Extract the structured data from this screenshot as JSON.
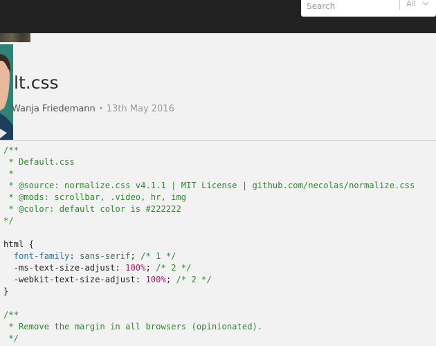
{
  "header": {
    "search_placeholder": "Search",
    "filter_label": "All",
    "colors": {
      "bar": "#222222"
    }
  },
  "post": {
    "title": "lt.css",
    "author": "Wanja Friedemann",
    "separator": "•",
    "date": "13th May 2016"
  },
  "code": {
    "lines": [
      [
        {
          "t": "/**",
          "k": "c"
        }
      ],
      [
        {
          "t": " * Default.css",
          "k": "c"
        }
      ],
      [
        {
          "t": " *",
          "k": "c"
        }
      ],
      [
        {
          "t": " * @source: normalize.css v4.1.1 | MIT License | github.com/necolas/normalize.css",
          "k": "c"
        }
      ],
      [
        {
          "t": " * @mods: scrollbar, .video, hr, img",
          "k": "c"
        }
      ],
      [
        {
          "t": " * @color: default color is #222222",
          "k": "c"
        }
      ],
      [
        {
          "t": "*/",
          "k": "c"
        }
      ],
      [],
      [
        {
          "t": "html {",
          "k": ""
        }
      ],
      [
        {
          "t": "  ",
          "k": ""
        },
        {
          "t": "font-family",
          "k": "p"
        },
        {
          "t": ": ",
          "k": ""
        },
        {
          "t": "sans-serif",
          "k": "v"
        },
        {
          "t": "; ",
          "k": ""
        },
        {
          "t": "/* 1 */",
          "k": "c"
        }
      ],
      [
        {
          "t": "  -ms-text-size-adjust: ",
          "k": ""
        },
        {
          "t": "100%",
          "k": "n"
        },
        {
          "t": "; ",
          "k": ""
        },
        {
          "t": "/* 2 */",
          "k": "c"
        }
      ],
      [
        {
          "t": "  -webkit-text-size-adjust: ",
          "k": ""
        },
        {
          "t": "100%",
          "k": "n"
        },
        {
          "t": "; ",
          "k": ""
        },
        {
          "t": "/* 2 */",
          "k": "c"
        }
      ],
      [
        {
          "t": "}",
          "k": ""
        }
      ],
      [],
      [
        {
          "t": "/**",
          "k": "c"
        }
      ],
      [
        {
          "t": " * Remove the margin in all browsers (opinionated).",
          "k": "c"
        }
      ],
      [
        {
          "t": " */",
          "k": "c"
        }
      ]
    ]
  }
}
